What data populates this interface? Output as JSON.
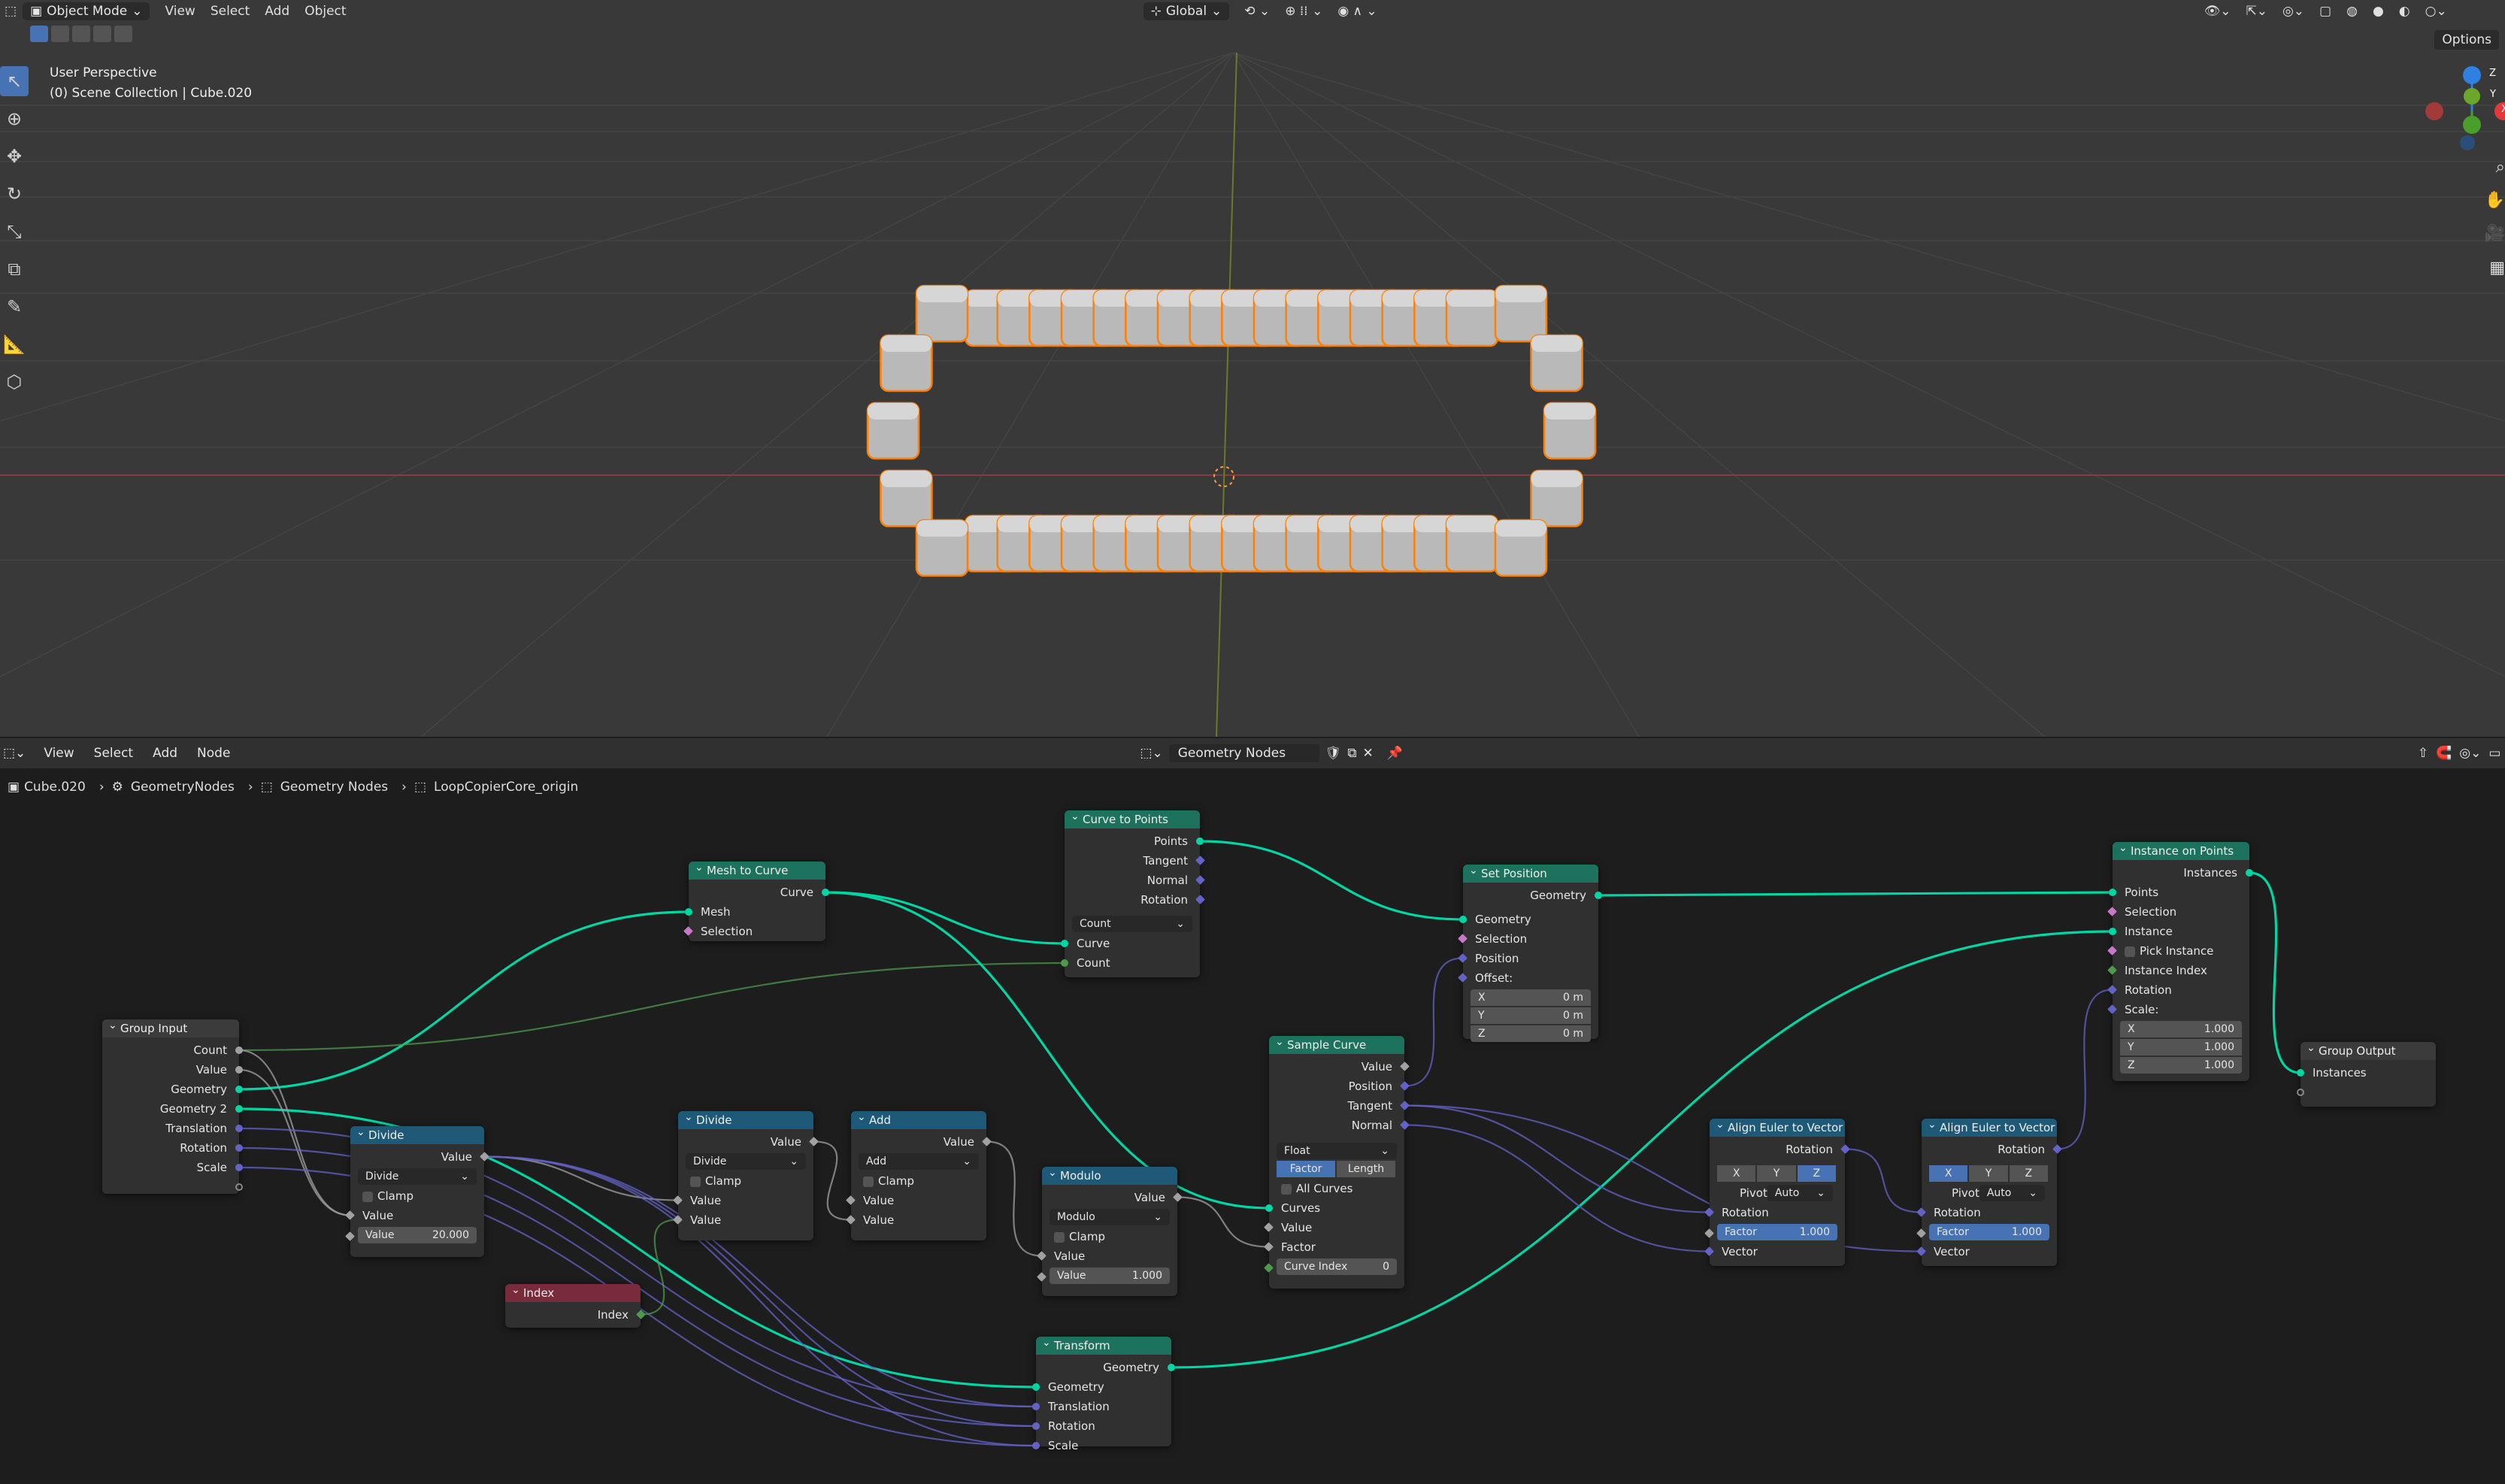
{
  "viewport": {
    "header": {
      "mode": "Object Mode",
      "menus": [
        "View",
        "Select",
        "Add",
        "Object"
      ],
      "transform_orientation": "Global",
      "options_label": "Options"
    },
    "overlay": {
      "perspective": "User Perspective",
      "collection": "(0) Scene Collection | Cube.020"
    },
    "gizmo_axes": [
      "Z",
      "Y",
      "X"
    ]
  },
  "node_editor": {
    "menus": [
      "View",
      "Select",
      "Add",
      "Node"
    ],
    "tree_type": "Geometry Nodes",
    "breadcrumbs": [
      "Cube.020",
      "GeometryNodes",
      "Geometry Nodes",
      "LoopCopierCore_origin"
    ],
    "nodes": {
      "group_input": {
        "title": "Group Input",
        "outputs": [
          "Count",
          "Value",
          "Geometry",
          "Geometry 2",
          "Translation",
          "Rotation",
          "Scale"
        ]
      },
      "divide1": {
        "title": "Divide",
        "out": "Value",
        "op": "Divide",
        "clamp": "Clamp",
        "in1": "Value",
        "in2": "Value",
        "in2_val": "20.000"
      },
      "index": {
        "title": "Index",
        "out": "Index"
      },
      "mesh_to_curve": {
        "title": "Mesh to Curve",
        "out": "Curve",
        "in1": "Mesh",
        "in2": "Selection"
      },
      "divide2": {
        "title": "Divide",
        "out": "Value",
        "op": "Divide",
        "clamp": "Clamp",
        "in1": "Value",
        "in2": "Value"
      },
      "add": {
        "title": "Add",
        "out": "Value",
        "op": "Add",
        "clamp": "Clamp",
        "in1": "Value",
        "in2": "Value"
      },
      "curve_to_points": {
        "title": "Curve to Points",
        "outs": [
          "Points",
          "Tangent",
          "Normal",
          "Rotation"
        ],
        "mode": "Count",
        "in1": "Curve",
        "in2": "Count"
      },
      "modulo": {
        "title": "Modulo",
        "out": "Value",
        "op": "Modulo",
        "clamp": "Clamp",
        "in1": "Value",
        "in2": "Value",
        "in2_val": "1.000"
      },
      "transform": {
        "title": "Transform",
        "out": "Geometry",
        "ins": [
          "Geometry",
          "Translation",
          "Rotation",
          "Scale"
        ]
      },
      "sample_curve": {
        "title": "Sample Curve",
        "outs": [
          "Value",
          "Position",
          "Tangent",
          "Normal"
        ],
        "type": "Float",
        "modes": [
          "Factor",
          "Length"
        ],
        "all_curves": "All Curves",
        "ins": [
          "Curves",
          "Value",
          "Factor"
        ],
        "curve_index": "Curve Index",
        "curve_index_val": "0"
      },
      "set_position": {
        "title": "Set Position",
        "out": "Geometry",
        "ins": [
          "Geometry",
          "Selection",
          "Position",
          "Offset:"
        ],
        "offset": [
          {
            "axis": "X",
            "val": "0 m"
          },
          {
            "axis": "Y",
            "val": "0 m"
          },
          {
            "axis": "Z",
            "val": "0 m"
          }
        ]
      },
      "align1": {
        "title": "Align Euler to Vector",
        "out": "Rotation",
        "axes": [
          "X",
          "Y",
          "Z"
        ],
        "pivot_label": "Pivot",
        "pivot": "Auto",
        "ins": [
          "Rotation",
          "Vector"
        ],
        "factor_label": "Factor",
        "factor": "1.000"
      },
      "align2": {
        "title": "Align Euler to Vector",
        "out": "Rotation",
        "axes": [
          "X",
          "Y",
          "Z"
        ],
        "pivot_label": "Pivot",
        "pivot": "Auto",
        "ins": [
          "Rotation",
          "Vector"
        ],
        "factor_label": "Factor",
        "factor": "1.000"
      },
      "instance_on_points": {
        "title": "Instance on Points",
        "out": "Instances",
        "ins": [
          "Points",
          "Selection",
          "Instance",
          "Pick Instance",
          "Instance Index",
          "Rotation",
          "Scale:"
        ],
        "scale": [
          {
            "axis": "X",
            "val": "1.000"
          },
          {
            "axis": "Y",
            "val": "1.000"
          },
          {
            "axis": "Z",
            "val": "1.000"
          }
        ]
      },
      "group_output": {
        "title": "Group Output",
        "in": "Instances"
      }
    }
  },
  "colors": {
    "geometry": "#00d6a3",
    "float": "#a1a1a1",
    "vector": "#6363c7",
    "int": "#4d9a4d",
    "select": "#ff8000"
  }
}
